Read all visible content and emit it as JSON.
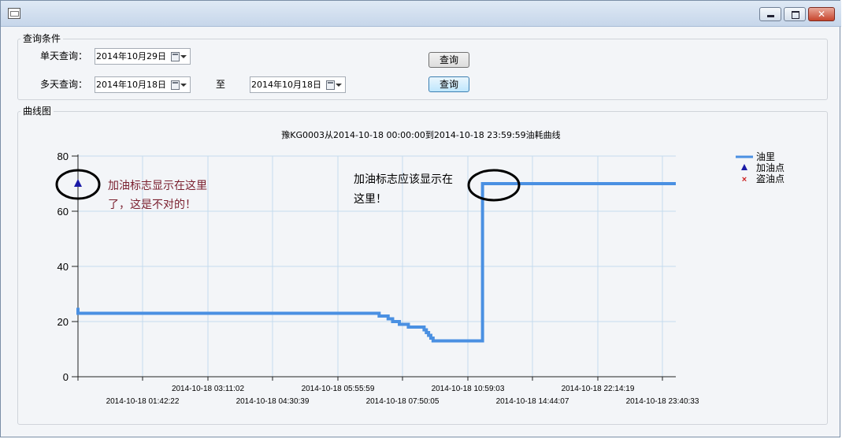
{
  "window": {
    "minimize_glyph": "",
    "maximize_glyph": "",
    "close_glyph": "✕"
  },
  "query": {
    "group_label": "查询条件",
    "single_day_label": "单天查询：",
    "single_day_date": "2014年10月29日",
    "single_day_button": "查询",
    "multi_day_label": "多天查询：",
    "multi_day_start": "2014年10月18日",
    "to_label": "至",
    "multi_day_end": "2014年10月18日",
    "multi_day_button": "查询"
  },
  "chart_group": {
    "label": "曲线图"
  },
  "annotations": {
    "wrong_line1": "加油标志显示在这里",
    "wrong_line2": "了，这是不对的！",
    "right_line1": "加油标志应该显示在",
    "right_line2": "这里！",
    "wrong_color": "#7a1f2e",
    "right_color": "#000000"
  },
  "chart_data": {
    "type": "line",
    "title": "豫KG0003从2014-10-18 00:00:00到2014-10-18 23:59:59油耗曲线",
    "xlabel": "",
    "ylabel": "",
    "x_range": [
      "2014-10-18 00:00:00",
      "2014-10-18 23:59:59"
    ],
    "ylim": [
      0,
      80
    ],
    "yticks": [
      0,
      20,
      40,
      60,
      80
    ],
    "xticks_row1": [
      "2014-10-18 03:11:02",
      "2014-10-18 05:55:59",
      "2014-10-18 10:59:03",
      "2014-10-18 22:14:19"
    ],
    "xticks_row2": [
      "2014-10-18 01:42:22",
      "2014-10-18 04:30:39",
      "2014-10-18 07:50:05",
      "2014-10-18 14:44:07",
      "2014-10-18 23:40:33"
    ],
    "grid": true,
    "legend_position": "top-right",
    "legend": [
      "油里",
      "加油点",
      "盗油点"
    ],
    "colors": {
      "fuel": "#4a90e2",
      "refuel": "#1a1aa6",
      "theft": "#cc2222"
    },
    "series": [
      {
        "name": "油里",
        "points": [
          [
            0.0,
            25
          ],
          [
            0.0,
            23
          ],
          [
            6.7,
            23
          ],
          [
            6.7,
            22
          ],
          [
            6.9,
            22
          ],
          [
            6.9,
            21
          ],
          [
            7.0,
            21
          ],
          [
            7.0,
            20
          ],
          [
            7.15,
            20
          ],
          [
            7.15,
            19
          ],
          [
            7.35,
            19
          ],
          [
            7.35,
            18
          ],
          [
            7.7,
            18
          ],
          [
            7.7,
            17
          ],
          [
            7.75,
            17
          ],
          [
            7.75,
            16
          ],
          [
            7.8,
            16
          ],
          [
            7.8,
            15
          ],
          [
            7.85,
            15
          ],
          [
            7.85,
            14
          ],
          [
            7.9,
            14
          ],
          [
            7.9,
            13
          ],
          [
            9.0,
            13
          ],
          [
            9.0,
            70
          ],
          [
            13.3,
            70
          ]
        ]
      },
      {
        "name": "加油点",
        "points": [
          [
            0.0,
            70
          ]
        ]
      }
    ]
  }
}
